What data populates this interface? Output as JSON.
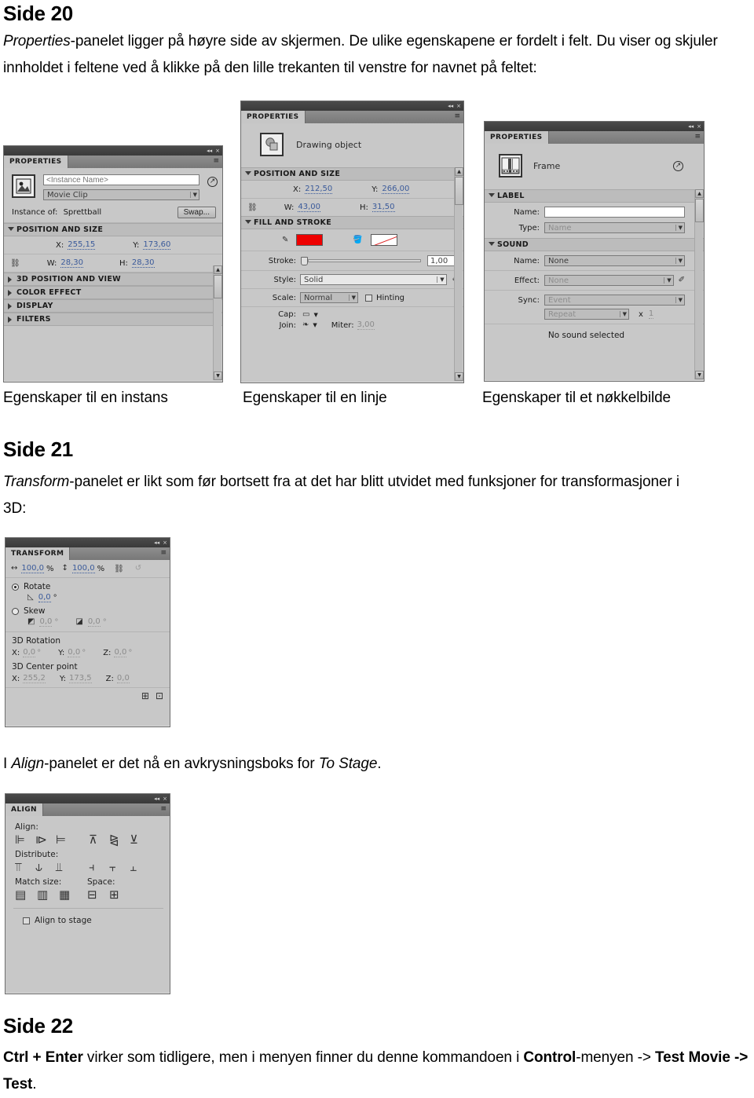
{
  "document": {
    "sections": [
      {
        "heading": "Side 20",
        "paragraph_parts": [
          {
            "text": "Properties",
            "style": "italic"
          },
          {
            "text": "-panelet ligger på høyre side av skjermen. De ulike egenskapene er fordelt i felt. Du viser og skjuler innholdet i feltene ved å klikke på den lille trekanten til venstre for navnet på feltet:",
            "style": "normal"
          }
        ]
      },
      {
        "heading": "Side 21",
        "paragraph_parts": [
          {
            "text": "Transform",
            "style": "italic"
          },
          {
            "text": "-panelet er likt som før bortsett fra at det har blitt utvidet med funksjoner for transformasjoner i 3D:",
            "style": "normal"
          }
        ]
      },
      {
        "heading": "Side 22",
        "paragraph_parts": [
          {
            "text": "Ctrl + Enter",
            "style": "bold"
          },
          {
            "text": " virker som tidligere, men i menyen finner du denne kommandoen i ",
            "style": "normal"
          },
          {
            "text": "Control",
            "style": "bold"
          },
          {
            "text": "-menyen -> ",
            "style": "normal"
          },
          {
            "text": "Test Movie -> Test",
            "style": "bold"
          },
          {
            "text": ".",
            "style": "normal"
          }
        ]
      }
    ],
    "align_intro_parts": [
      {
        "text": "I ",
        "style": "normal"
      },
      {
        "text": "Align",
        "style": "italic"
      },
      {
        "text": "-panelet er det nå en avkrysningsboks for ",
        "style": "normal"
      },
      {
        "text": "To Stage",
        "style": "italic"
      },
      {
        "text": ".",
        "style": "normal"
      }
    ],
    "captions": {
      "instance": "Egenskaper til en instans",
      "line": "Egenskaper til en linje",
      "keyframe": "Egenskaper til et nøkkelbilde"
    }
  },
  "panel_instance": {
    "tab_label": "PROPERTIES",
    "titlebar": {
      "collapse_icon": "◂◂",
      "close_icon": "×"
    },
    "menu_icon": "≡",
    "instance_name_placeholder": "<Instance Name>",
    "symbol_type": "Movie Clip",
    "instance_of_label": "Instance of:",
    "instance_of_value": "Sprettball",
    "swap_button": "Swap...",
    "sections": [
      {
        "name": "POSITION AND SIZE",
        "expanded": true
      },
      {
        "name": "3D POSITION AND VIEW",
        "expanded": false
      },
      {
        "name": "COLOR EFFECT",
        "expanded": false
      },
      {
        "name": "DISPLAY",
        "expanded": false
      },
      {
        "name": "FILTERS",
        "expanded": false
      }
    ],
    "position": {
      "x_label": "X:",
      "x_value": "255,15",
      "y_label": "Y:",
      "y_value": "173,60"
    },
    "size": {
      "w_label": "W:",
      "w_value": "28,30",
      "h_label": "H:",
      "h_value": "28,30"
    }
  },
  "panel_drawing": {
    "tab_label": "PROPERTIES",
    "titlebar": {
      "collapse_icon": "◂◂",
      "close_icon": "×"
    },
    "menu_icon": "≡",
    "object_type": "Drawing object",
    "sections": [
      {
        "name": "POSITION AND SIZE",
        "expanded": true
      },
      {
        "name": "FILL AND STROKE",
        "expanded": true
      }
    ],
    "position": {
      "x_label": "X:",
      "x_value": "212,50",
      "y_label": "Y:",
      "y_value": "266,00"
    },
    "size": {
      "w_label": "W:",
      "w_value": "43,00",
      "h_label": "H:",
      "h_value": "31,50"
    },
    "fill_stroke": {
      "stroke_color": "#ee0000",
      "fill_color": "none",
      "stroke_label": "Stroke:",
      "stroke_value": "1,00",
      "style_label": "Style:",
      "style_value": "Solid",
      "scale_label": "Scale:",
      "scale_value": "Normal",
      "hinting_label": "Hinting",
      "hinting_checked": false,
      "cap_label": "Cap:",
      "join_label": "Join:",
      "miter_label": "Miter:",
      "miter_value": "3,00"
    }
  },
  "panel_frame": {
    "tab_label": "PROPERTIES",
    "titlebar": {
      "collapse_icon": "◂◂",
      "close_icon": "×"
    },
    "menu_icon": "≡",
    "object_type": "Frame",
    "sections": [
      {
        "name": "LABEL",
        "expanded": true
      },
      {
        "name": "SOUND",
        "expanded": true
      }
    ],
    "label": {
      "name_label": "Name:",
      "name_value": "",
      "type_label": "Type:",
      "type_value": "Name"
    },
    "sound": {
      "name_label": "Name:",
      "name_value": "None",
      "effect_label": "Effect:",
      "effect_value": "None",
      "sync_label": "Sync:",
      "sync_value": "Event",
      "repeat_value": "Repeat",
      "times_label": "x",
      "times_value": "1",
      "status": "No sound selected"
    }
  },
  "panel_transform": {
    "tab_label": "TRANSFORM",
    "titlebar": {
      "collapse_icon": "◂◂",
      "close_icon": "×"
    },
    "menu_icon": "≡",
    "scale_w_value": "100,0",
    "scale_w_unit": "%",
    "scale_h_value": "100,0",
    "scale_h_unit": "%",
    "rotate_label": "Rotate",
    "rotate_selected": true,
    "rotate_value": "0,0",
    "degree": "°",
    "skew_label": "Skew",
    "skew_selected": false,
    "skew_x_value": "0,0",
    "skew_y_value": "0,0",
    "rotation3d_title": "3D Rotation",
    "rotation3d": {
      "x_label": "X:",
      "x_value": "0,0",
      "y_label": "Y:",
      "y_value": "0,0",
      "z_label": "Z:",
      "z_value": "0,0"
    },
    "center3d_title": "3D Center point",
    "center3d": {
      "x_label": "X:",
      "x_value": "255,2",
      "y_label": "Y:",
      "y_value": "173,5",
      "z_label": "Z:",
      "z_value": "0,0"
    }
  },
  "panel_align": {
    "tab_label": "ALIGN",
    "titlebar": {
      "collapse_icon": "◂◂",
      "close_icon": "×"
    },
    "menu_icon": "≡",
    "align_label": "Align:",
    "distribute_label": "Distribute:",
    "match_size_label": "Match size:",
    "space_label": "Space:",
    "align_to_stage_label": "Align to stage",
    "align_to_stage_checked": false
  }
}
